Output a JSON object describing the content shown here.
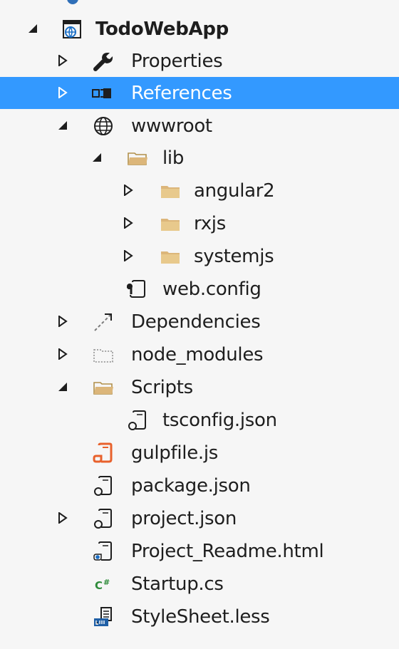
{
  "solution_explorer": {
    "project": {
      "label": "TodoWebApp",
      "icon": "web-project-icon",
      "expanded": true
    },
    "items": [
      {
        "label": "Properties",
        "icon": "wrench-icon",
        "expanded": false
      },
      {
        "label": "References",
        "icon": "references-icon",
        "expanded": false,
        "selected": true
      },
      {
        "label": "wwwroot",
        "icon": "globe-icon",
        "expanded": true
      },
      {
        "label": "lib",
        "icon": "folder-open-icon",
        "expanded": true
      },
      {
        "label": "angular2",
        "icon": "folder-icon",
        "expanded": false
      },
      {
        "label": "rxjs",
        "icon": "folder-icon",
        "expanded": false
      },
      {
        "label": "systemjs",
        "icon": "folder-icon",
        "expanded": false
      },
      {
        "label": "web.config",
        "icon": "config-file-icon"
      },
      {
        "label": "Dependencies",
        "icon": "dependencies-icon",
        "expanded": false
      },
      {
        "label": "node_modules",
        "icon": "hidden-folder-icon",
        "expanded": false
      },
      {
        "label": "Scripts",
        "icon": "folder-open-icon",
        "expanded": true
      },
      {
        "label": "tsconfig.json",
        "icon": "json-file-icon"
      },
      {
        "label": "gulpfile.js",
        "icon": "js-file-icon"
      },
      {
        "label": "package.json",
        "icon": "json-file-icon"
      },
      {
        "label": "project.json",
        "icon": "json-file-icon",
        "expanded": false
      },
      {
        "label": "Project_Readme.html",
        "icon": "html-file-icon"
      },
      {
        "label": "Startup.cs",
        "icon": "csharp-file-icon"
      },
      {
        "label": "StyleSheet.less",
        "icon": "less-file-icon"
      }
    ]
  },
  "colors": {
    "selection": "#3399ff",
    "background": "#f6f6f6",
    "folder": "#dcb67a",
    "gulp": "#e8612c"
  }
}
